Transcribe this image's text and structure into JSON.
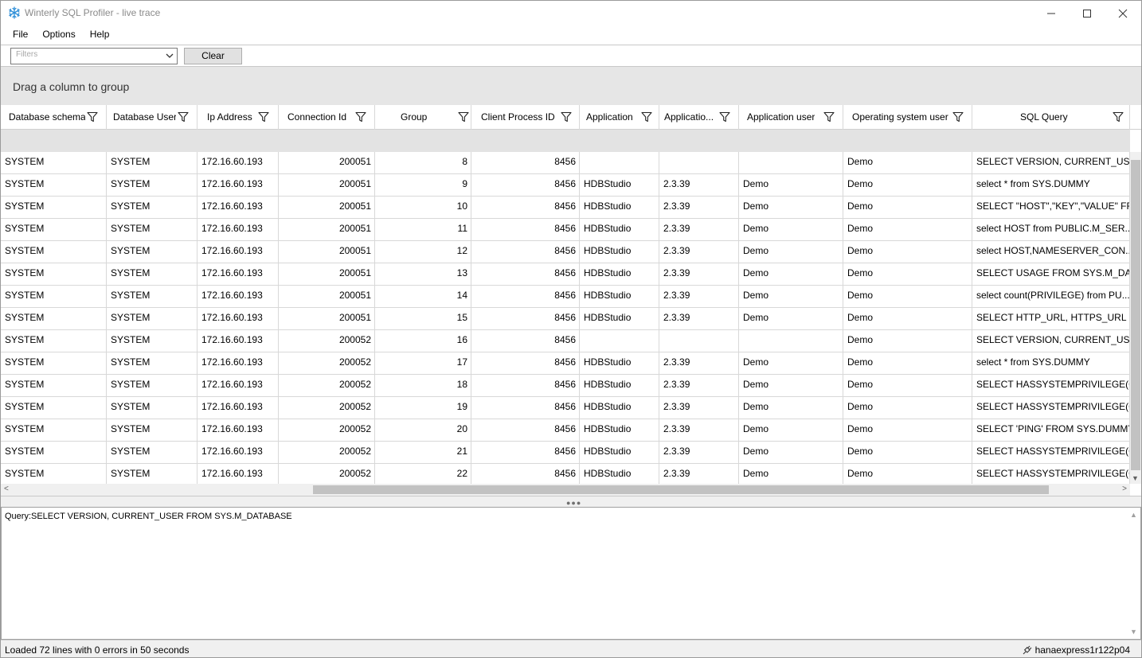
{
  "window": {
    "title": "Winterly SQL Profiler - live trace",
    "controls": {
      "minimize": "—",
      "maximize": "☐",
      "close": "✕"
    }
  },
  "menu": [
    "File",
    "Options",
    "Help"
  ],
  "toolbar": {
    "filter_placeholder": "Filters",
    "clear_label": "Clear"
  },
  "group_panel": {
    "text": "Drag a column to group"
  },
  "grid": {
    "columns": [
      "Database schema",
      "Database User",
      "Ip Address",
      "Connection Id",
      "Group",
      "Client Process ID",
      "Application",
      "Applicatio...",
      "Application user",
      "Operating system user",
      "SQL Query"
    ],
    "rows": [
      [
        "SYSTEM",
        "SYSTEM",
        "172.16.60.193",
        "200051",
        "8",
        "8456",
        "",
        "",
        "",
        "Demo",
        "SELECT  VERSION,  CURRENT_USE..."
      ],
      [
        "SYSTEM",
        "SYSTEM",
        "172.16.60.193",
        "200051",
        "9",
        "8456",
        "HDBStudio",
        "2.3.39",
        "Demo",
        "Demo",
        "select * from SYS.DUMMY"
      ],
      [
        "SYSTEM",
        "SYSTEM",
        "172.16.60.193",
        "200051",
        "10",
        "8456",
        "HDBStudio",
        "2.3.39",
        "Demo",
        "Demo",
        "SELECT  \"HOST\",\"KEY\",\"VALUE\"  FR..."
      ],
      [
        "SYSTEM",
        "SYSTEM",
        "172.16.60.193",
        "200051",
        "11",
        "8456",
        "HDBStudio",
        "2.3.39",
        "Demo",
        "Demo",
        "select  HOST  from  PUBLIC.M_SER..."
      ],
      [
        "SYSTEM",
        "SYSTEM",
        "172.16.60.193",
        "200051",
        "12",
        "8456",
        "HDBStudio",
        "2.3.39",
        "Demo",
        "Demo",
        "select  HOST,NAMESERVER_CON..."
      ],
      [
        "SYSTEM",
        "SYSTEM",
        "172.16.60.193",
        "200051",
        "13",
        "8456",
        "HDBStudio",
        "2.3.39",
        "Demo",
        "Demo",
        "SELECT  USAGE  FROM  SYS.M_DAT..."
      ],
      [
        "SYSTEM",
        "SYSTEM",
        "172.16.60.193",
        "200051",
        "14",
        "8456",
        "HDBStudio",
        "2.3.39",
        "Demo",
        "Demo",
        "select  count(PRIVILEGE)  from  PU..."
      ],
      [
        "SYSTEM",
        "SYSTEM",
        "172.16.60.193",
        "200051",
        "15",
        "8456",
        "HDBStudio",
        "2.3.39",
        "Demo",
        "Demo",
        "SELECT  HTTP_URL,  HTTPS_URL  F..."
      ],
      [
        "SYSTEM",
        "SYSTEM",
        "172.16.60.193",
        "200052",
        "16",
        "8456",
        "",
        "",
        "",
        "Demo",
        "SELECT  VERSION,  CURRENT_USE..."
      ],
      [
        "SYSTEM",
        "SYSTEM",
        "172.16.60.193",
        "200052",
        "17",
        "8456",
        "HDBStudio",
        "2.3.39",
        "Demo",
        "Demo",
        "select * from SYS.DUMMY"
      ],
      [
        "SYSTEM",
        "SYSTEM",
        "172.16.60.193",
        "200052",
        "18",
        "8456",
        "HDBStudio",
        "2.3.39",
        "Demo",
        "Demo",
        "SELECT  HASSYSTEMPRIVILEGE(C..."
      ],
      [
        "SYSTEM",
        "SYSTEM",
        "172.16.60.193",
        "200052",
        "19",
        "8456",
        "HDBStudio",
        "2.3.39",
        "Demo",
        "Demo",
        "SELECT  HASSYSTEMPRIVILEGE(C..."
      ],
      [
        "SYSTEM",
        "SYSTEM",
        "172.16.60.193",
        "200052",
        "20",
        "8456",
        "HDBStudio",
        "2.3.39",
        "Demo",
        "Demo",
        "SELECT 'PING' FROM SYS.DUMMY"
      ],
      [
        "SYSTEM",
        "SYSTEM",
        "172.16.60.193",
        "200052",
        "21",
        "8456",
        "HDBStudio",
        "2.3.39",
        "Demo",
        "Demo",
        "SELECT  HASSYSTEMPRIVILEGE(C..."
      ],
      [
        "SYSTEM",
        "SYSTEM",
        "172.16.60.193",
        "200052",
        "22",
        "8456",
        "HDBStudio",
        "2.3.39",
        "Demo",
        "Demo",
        "SELECT  HASSYSTEMPRIVILEGE(C..."
      ]
    ]
  },
  "query_panel": {
    "text": "Query:SELECT VERSION, CURRENT_USER FROM SYS.M_DATABASE"
  },
  "status": {
    "message": "Loaded 72 lines with 0 errors in 50 seconds",
    "connection": "hanaexpress1r122p04"
  },
  "colors": {
    "accent_icon": "#2f8fd8",
    "group_panel_bg": "#e6e6e6",
    "grid_line": "#d8d8d8"
  },
  "icons": {
    "app": "snowflake-icon",
    "filter": "funnel-icon",
    "connection": "plug-icon"
  }
}
